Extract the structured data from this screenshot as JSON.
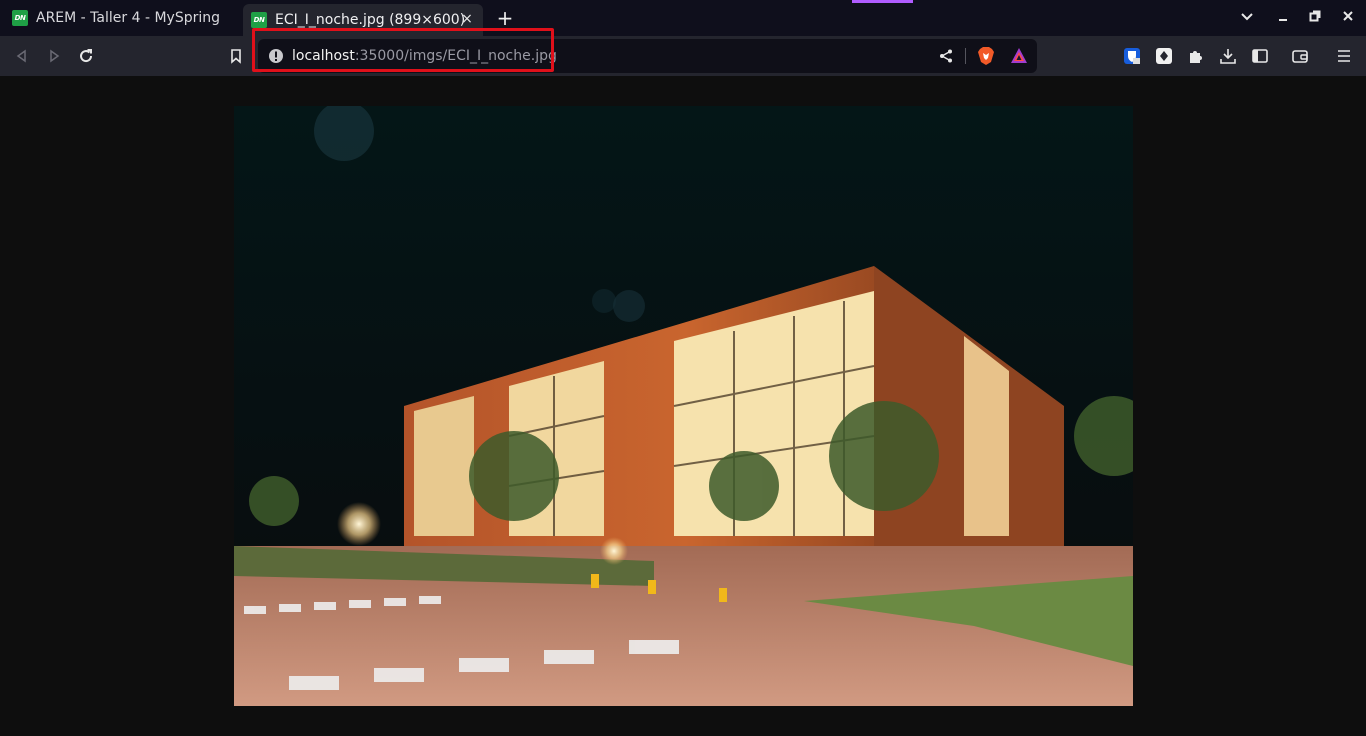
{
  "tabs": [
    {
      "favicon_text": "DN",
      "title": "AREM - Taller 4 - MySpring"
    },
    {
      "favicon_text": "DN",
      "title": "ECI_I_noche.jpg (899×600)",
      "close": "×"
    }
  ],
  "new_tab": "+",
  "address": {
    "host": "localhost",
    "path": ":35000/imgs/ECI_I_noche.jpg"
  },
  "image": {
    "alt": "ECI_I_noche.jpg",
    "description_icon": "photo-icon"
  },
  "colors": {
    "highlight": "#e0101a",
    "brand_favicon": "#1fa046",
    "accent_strip": "#b05cff"
  },
  "window_controls": {
    "dropdown": "⌄",
    "minimize": "–",
    "maximize": "❐",
    "close": "✕"
  }
}
